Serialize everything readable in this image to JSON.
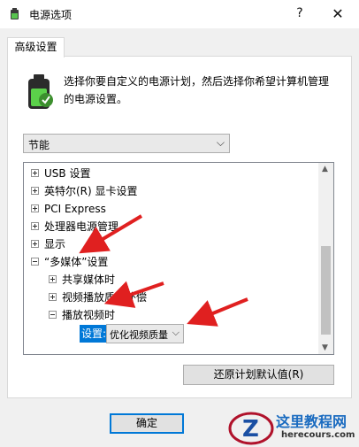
{
  "window": {
    "title": "电源选项",
    "help_label": "?",
    "close_label": "✕"
  },
  "tab": {
    "label": "高级设置"
  },
  "description": "选择你要自定义的电源计划，然后选择你希望计算机管理的电源设置。",
  "plan_dropdown": {
    "selected": "节能"
  },
  "tree": {
    "items": [
      {
        "label": "USB 设置"
      },
      {
        "label": "英特尔(R) 显卡设置"
      },
      {
        "label": "PCI Express"
      },
      {
        "label": "处理器电源管理"
      },
      {
        "label": "显示"
      },
      {
        "label": "“多媒体”设置"
      },
      {
        "label": "共享媒体时"
      },
      {
        "label": "视频播放质量补偿"
      },
      {
        "label": "播放视频时"
      }
    ],
    "setting_label": "设置:",
    "setting_value": "优化视频质量"
  },
  "buttons": {
    "restore": "还原计划默认值(R)",
    "ok": "确定"
  },
  "watermark": {
    "title": "这里教程网",
    "url": "herecours.com"
  },
  "colors": {
    "accent": "#0078d7",
    "arrow": "#e02020"
  }
}
